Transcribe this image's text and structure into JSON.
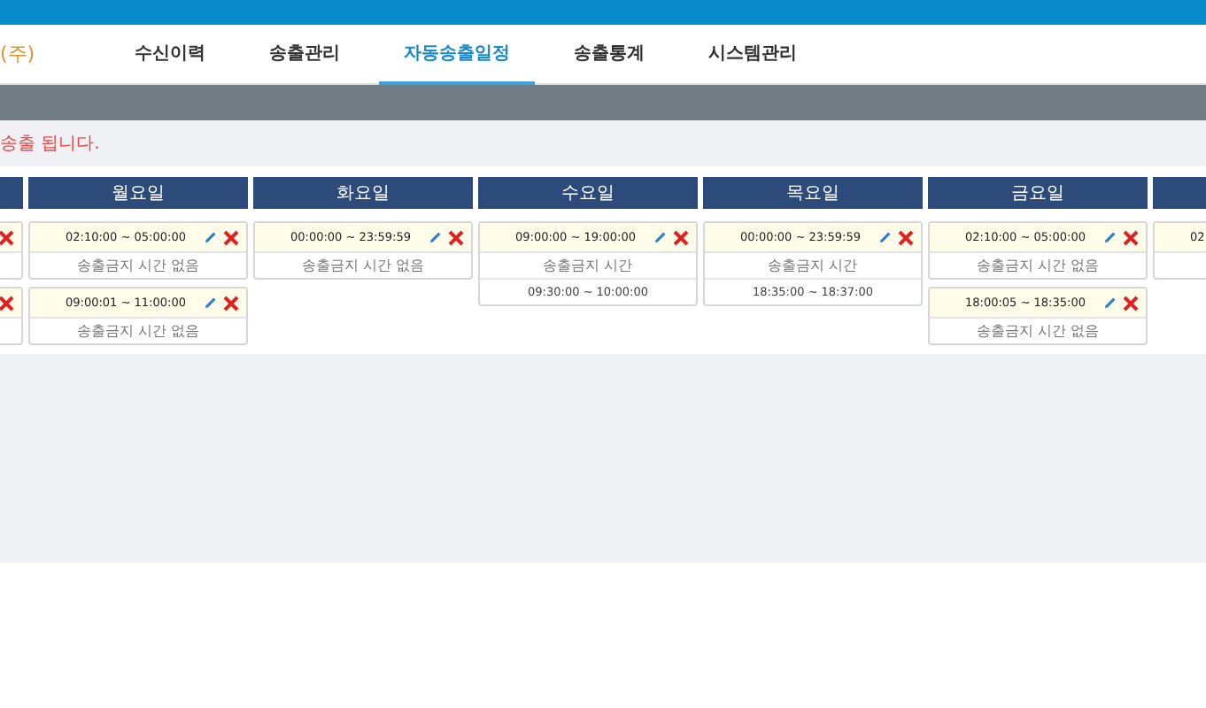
{
  "header": {
    "logo": "(주)",
    "tabs": [
      {
        "label": "수신이력",
        "selected": false
      },
      {
        "label": "송출관리",
        "selected": false
      },
      {
        "label": "자동송출일정",
        "selected": true
      },
      {
        "label": "송출통계",
        "selected": false
      },
      {
        "label": "시스템관리",
        "selected": false
      }
    ]
  },
  "notice": "송출 됩니다.",
  "days": [
    {
      "entries": [
        {
          "deletable": true
        },
        {
          "deletable": true
        }
      ]
    },
    {
      "name": "월요일",
      "entries": [
        {
          "time": "02:10:00 ~ 05:00:00",
          "note": "송출금지 시간 없음",
          "deletable": true
        },
        {
          "time": "09:00:01 ~ 11:00:00",
          "note": "송출금지 시간 없음",
          "deletable": true
        }
      ]
    },
    {
      "name": "화요일",
      "entries": [
        {
          "time": "00:00:00 ~ 23:59:59",
          "note": "송출금지 시간 없음",
          "deletable": true
        }
      ]
    },
    {
      "name": "수요일",
      "entries": [
        {
          "time": "09:00:00 ~ 19:00:00",
          "note": "송출금지 시간",
          "ranges": [
            "09:30:00 ~ 10:00:00"
          ],
          "deletable": true
        }
      ]
    },
    {
      "name": "목요일",
      "entries": [
        {
          "time": "00:00:00 ~ 23:59:59",
          "note": "송출금지 시간",
          "ranges": [
            "18:35:00 ~ 18:37:00"
          ],
          "deletable": true
        }
      ]
    },
    {
      "name": "금요일",
      "entries": [
        {
          "time": "02:10:00 ~ 05:00:00",
          "note": "송출금지 시간 없음",
          "deletable": true
        },
        {
          "time": "18:00:05 ~ 18:35:00",
          "note": "송출금지 시간 없음",
          "deletable": true
        }
      ]
    },
    {
      "entries": [
        {
          "time": "02"
        }
      ]
    }
  ]
}
